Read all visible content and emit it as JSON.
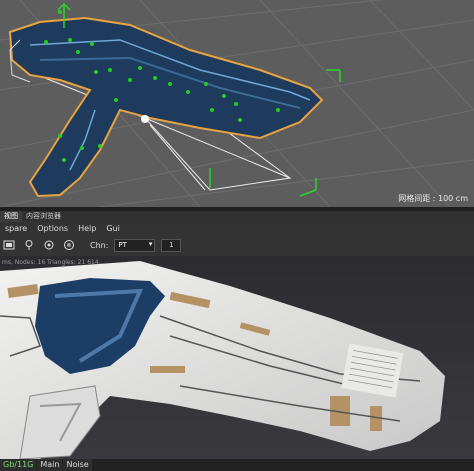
{
  "viewport": {
    "grid_readout": "网格间距 : 100 cm"
  },
  "panel_tabs": [
    "视图",
    "内容浏览器"
  ],
  "menu": [
    "spare",
    "Options",
    "Help",
    "Gui"
  ],
  "toolbar": {
    "chn_label": "Chn:",
    "chn_value": "PT",
    "step_value": "1"
  },
  "render": {
    "info": "ms, Nodes: 16 Triangles: 21 614..."
  },
  "statusbar": {
    "memory": "Gb/11G",
    "tabs": [
      "Main",
      "Noise"
    ]
  },
  "colors": {
    "viewport_bg": "#5d5d5d",
    "selection_outline": "#e8a341",
    "point_green": "#1fd01f",
    "hull_blue": "#1e3a5c"
  }
}
